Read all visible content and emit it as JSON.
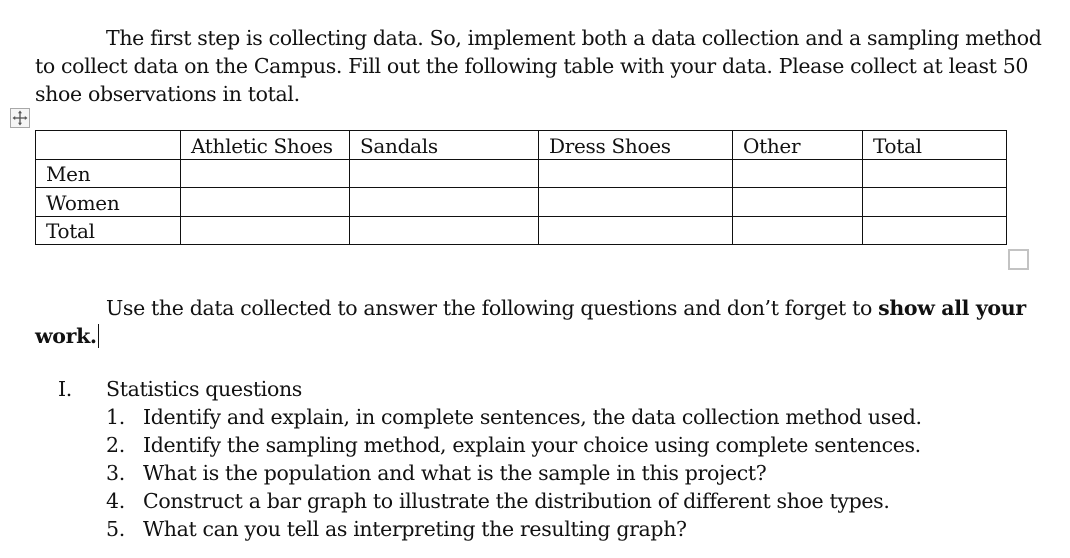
{
  "intro": {
    "line1": "The first step is collecting data. So, implement both a data collection and a sampling method",
    "line2": "to collect data on the Campus.  Fill out the following table with your data. Please collect at least 50",
    "line3": "shoe observations in total."
  },
  "table": {
    "columns": [
      "",
      "Athletic Shoes",
      "Sandals",
      "Dress Shoes",
      "Other",
      "Total"
    ],
    "rows": [
      {
        "label": "Men",
        "cells": [
          "",
          "",
          "",
          "",
          ""
        ]
      },
      {
        "label": "Women",
        "cells": [
          "",
          "",
          "",
          "",
          ""
        ]
      },
      {
        "label": "Total",
        "cells": [
          "",
          "",
          "",
          "",
          ""
        ]
      }
    ]
  },
  "instruction": {
    "line1_prefix": "Use the data collected to answer the following questions and don’t forget to ",
    "line1_bold": "show all your",
    "line2_bold": "work."
  },
  "section": {
    "numeral": "I.",
    "title": "Statistics questions",
    "questions": [
      {
        "num": "1.",
        "text": "Identify and explain, in complete sentences, the data collection method used."
      },
      {
        "num": "2.",
        "text": "Identify the sampling method, explain your choice using complete sentences."
      },
      {
        "num": "3.",
        "text": "What is the population and what is the sample in this project?"
      },
      {
        "num": "4.",
        "text": "Construct a bar graph to illustrate the distribution of different shoe types."
      },
      {
        "num": "5.",
        "text": "What can you tell as interpreting the resulting graph?"
      }
    ]
  }
}
